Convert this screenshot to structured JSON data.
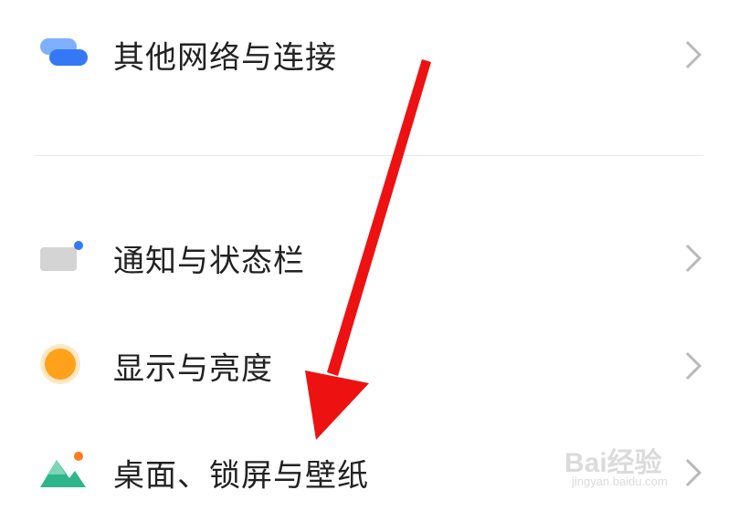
{
  "settings": {
    "items": [
      {
        "label": "其他网络与连接",
        "icon": "network-icon"
      },
      {
        "label": "通知与状态栏",
        "icon": "notification-icon"
      },
      {
        "label": "显示与亮度",
        "icon": "brightness-icon"
      },
      {
        "label": "桌面、锁屏与壁纸",
        "icon": "wallpaper-icon"
      }
    ]
  },
  "annotation": {
    "arrow_color": "#ee1111"
  },
  "watermark": {
    "logo_text": "Bai经验",
    "url_text": "jingyan.baidu.com"
  },
  "colors": {
    "network_blue": "#3478f6",
    "brightness_orange": "#ffa11a",
    "wallpaper_green": "#2fb58a",
    "accent_orange": "#ff7a1a"
  }
}
